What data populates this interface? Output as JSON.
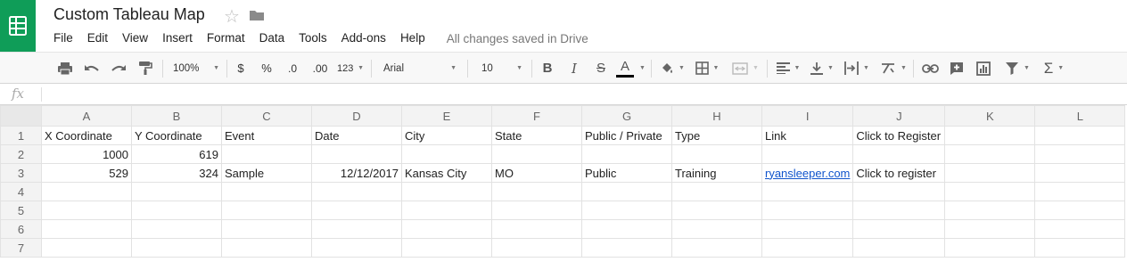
{
  "header": {
    "title": "Custom Tableau Map",
    "save_status": "All changes saved in Drive"
  },
  "menu": [
    "File",
    "Edit",
    "View",
    "Insert",
    "Format",
    "Data",
    "Tools",
    "Add-ons",
    "Help"
  ],
  "toolbar": {
    "zoom": "100%",
    "currency": "$",
    "percent": "%",
    "decrease_decimal": ".0",
    "increase_decimal": ".00",
    "more_formats": "123",
    "font": "Arial",
    "font_size": "10",
    "bold": "B",
    "italic": "I",
    "strikethrough": "S",
    "text_color": "A",
    "sigma": "Σ"
  },
  "formula_bar": {
    "label": "fx",
    "value": ""
  },
  "columns": [
    "A",
    "B",
    "C",
    "D",
    "E",
    "F",
    "G",
    "H",
    "I",
    "J",
    "K",
    "L"
  ],
  "rows": [
    {
      "num": "1",
      "cells": [
        "X Coordinate",
        "Y Coordinate",
        "Event",
        "Date",
        "City",
        "State",
        "Public / Private",
        "Type",
        "Link",
        "Click to Register",
        "",
        ""
      ]
    },
    {
      "num": "2",
      "cells": [
        "1000",
        "619",
        "",
        "",
        "",
        "",
        "",
        "",
        "",
        "",
        "",
        ""
      ]
    },
    {
      "num": "3",
      "cells": [
        "529",
        "324",
        "Sample",
        "12/12/2017",
        "Kansas City",
        "MO",
        "Public",
        "Training",
        "ryansleeper.com",
        "Click to register",
        "",
        ""
      ]
    },
    {
      "num": "4",
      "cells": [
        "",
        "",
        "",
        "",
        "",
        "",
        "",
        "",
        "",
        "",
        "",
        ""
      ]
    },
    {
      "num": "5",
      "cells": [
        "",
        "",
        "",
        "",
        "",
        "",
        "",
        "",
        "",
        "",
        "",
        ""
      ]
    },
    {
      "num": "6",
      "cells": [
        "",
        "",
        "",
        "",
        "",
        "",
        "",
        "",
        "",
        "",
        "",
        ""
      ]
    },
    {
      "num": "7",
      "cells": [
        "",
        "",
        "",
        "",
        "",
        "",
        "",
        "",
        "",
        "",
        "",
        ""
      ]
    }
  ],
  "icons": {
    "app": "sheets-logo-icon",
    "star": "star-icon",
    "folder": "folder-icon",
    "print": "print-icon",
    "undo": "undo-icon",
    "redo": "redo-icon",
    "paint_format": "paint-format-icon",
    "fill": "fill-color-icon",
    "borders": "borders-icon",
    "merge": "merge-cells-icon",
    "align": "horizontal-align-icon",
    "valign": "vertical-align-icon",
    "wrap": "text-wrap-icon",
    "rotate": "text-rotation-icon",
    "link": "insert-link-icon",
    "comment": "insert-comment-icon",
    "chart": "insert-chart-icon",
    "filter": "filter-icon"
  },
  "colors": {
    "brand": "#0f9d58",
    "link": "#1155cc",
    "text_color_underline": "#000000"
  }
}
